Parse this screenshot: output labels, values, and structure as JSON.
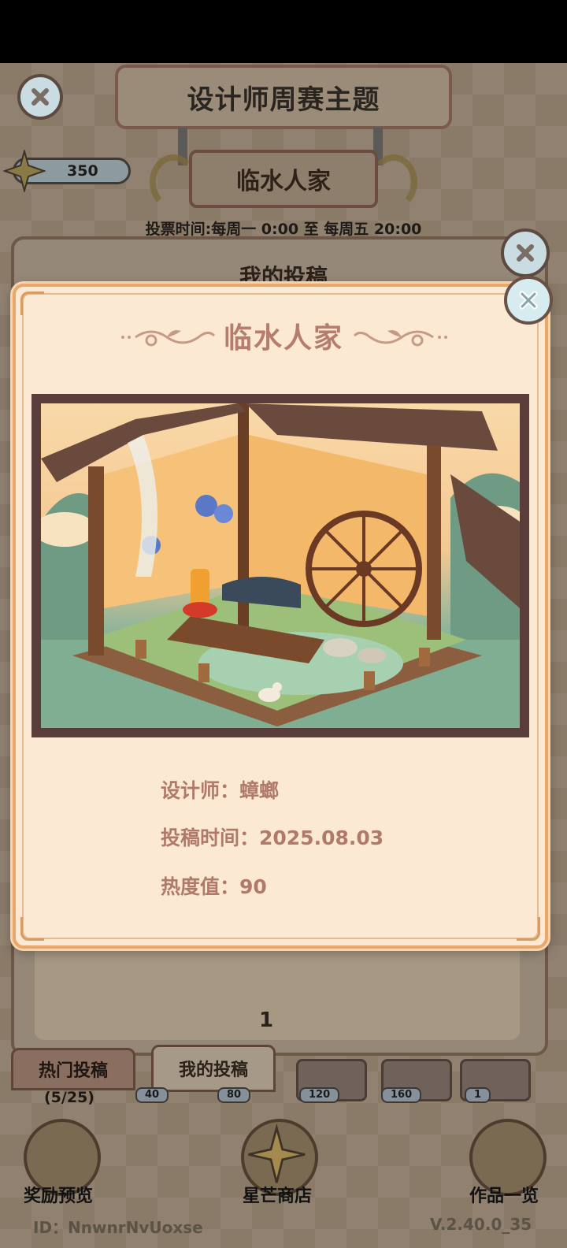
{
  "background": {
    "title": "设计师周赛主题",
    "theme_plaque": "临水人家",
    "star_count": "350",
    "vote_time": "投票时间:每周一 0:00 至 每周五 20:00",
    "panel_title": "我的投稿",
    "page_number": "1",
    "tabs": {
      "hot": "热门投稿",
      "mine": "我的投稿"
    },
    "submission_count": "(5/25)",
    "milestones": [
      "40",
      "80",
      "120",
      "160",
      "1"
    ],
    "bottom_buttons": {
      "rewards": "奖励预览",
      "shop": "星芒商店",
      "works": "作品一览"
    },
    "footer_id": "ID：NnwnrNvUoxse",
    "footer_version": "V.2.40.0_35"
  },
  "modal": {
    "title": "临水人家",
    "designer": "设计师：蟑螂",
    "submit_time": "投稿时间：2025.08.03",
    "heat": "热度值：90"
  },
  "icons": {
    "close": "close-icon",
    "star": "star-icon",
    "flourish": "flourish-ornament"
  },
  "colors": {
    "modal_bg": "#fbe9d4",
    "modal_border": "#e9a86a",
    "title_text": "#b67c6e",
    "info_text": "#b07a6a",
    "artwork_frame": "#5a3c3a"
  }
}
